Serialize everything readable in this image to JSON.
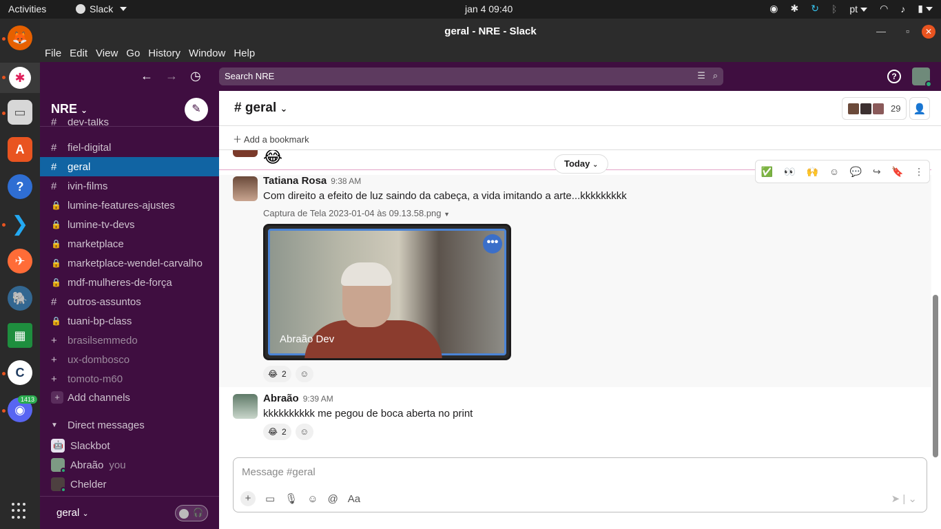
{
  "system": {
    "activities": "Activities",
    "app_name": "Slack",
    "clock": "jan 4  09:40",
    "language": "pt"
  },
  "dock": {
    "discord_badge": "1413"
  },
  "window": {
    "title": "geral - NRE - Slack",
    "close": "✕"
  },
  "menubar": [
    "File",
    "Edit",
    "View",
    "Go",
    "History",
    "Window",
    "Help"
  ],
  "search": {
    "placeholder": "Search NRE"
  },
  "sidebar": {
    "workspace": "NRE",
    "channels": [
      {
        "name": "dev-talks",
        "sym": "#"
      },
      {
        "name": "fiel-digital",
        "sym": "#"
      },
      {
        "name": "geral",
        "sym": "#",
        "active": true
      },
      {
        "name": "ivin-films",
        "sym": "#"
      },
      {
        "name": "lumine-features-ajustes",
        "sym": "🔒"
      },
      {
        "name": "lumine-tv-devs",
        "sym": "🔒"
      },
      {
        "name": "marketplace",
        "sym": "🔒"
      },
      {
        "name": "marketplace-wendel-carvalho",
        "sym": "🔒"
      },
      {
        "name": "mdf-mulheres-de-força",
        "sym": "🔒"
      },
      {
        "name": "outros-assuntos",
        "sym": "#"
      },
      {
        "name": "tuani-bp-class",
        "sym": "🔒"
      },
      {
        "name": "brasilsemmedo",
        "sym": "+"
      },
      {
        "name": "ux-dombosco",
        "sym": "+"
      },
      {
        "name": "tomoto-m60",
        "sym": "+"
      }
    ],
    "add_channels": "Add channels",
    "dm_header": "Direct messages",
    "dms": [
      {
        "name": "Slackbot",
        "suffix": ""
      },
      {
        "name": "Abraão",
        "suffix": "you"
      },
      {
        "name": "Chelder",
        "suffix": ""
      }
    ],
    "footer_channel": "geral"
  },
  "channel": {
    "name": "# geral",
    "member_count": "29",
    "add_bookmark": "Add a bookmark"
  },
  "messages": {
    "today": "Today",
    "m1": {
      "author": "Tatiana Rosa",
      "time": "9:38 AM",
      "text": "Com direito a efeito de luz saindo da cabeça, a vida imitando a arte...kkkkkkkkk",
      "file_name": "Captura de Tela 2023-01-04 às 09.13.58.png",
      "image_label": "Abraão Dev",
      "reaction_emoji": "😂",
      "reaction_count": "2"
    },
    "m2": {
      "author": "Abraão",
      "time": "9:39 AM",
      "text": "kkkkkkkkkk me pegou de boca aberta no print",
      "reaction_emoji": "😂",
      "reaction_count": "2"
    },
    "toolbar": [
      "✅",
      "👀",
      "🙌",
      "add-reaction",
      "reply-in-thread",
      "share",
      "bookmark",
      "more"
    ]
  },
  "composer": {
    "placeholder": "Message #geral",
    "format_label": "Aa"
  }
}
